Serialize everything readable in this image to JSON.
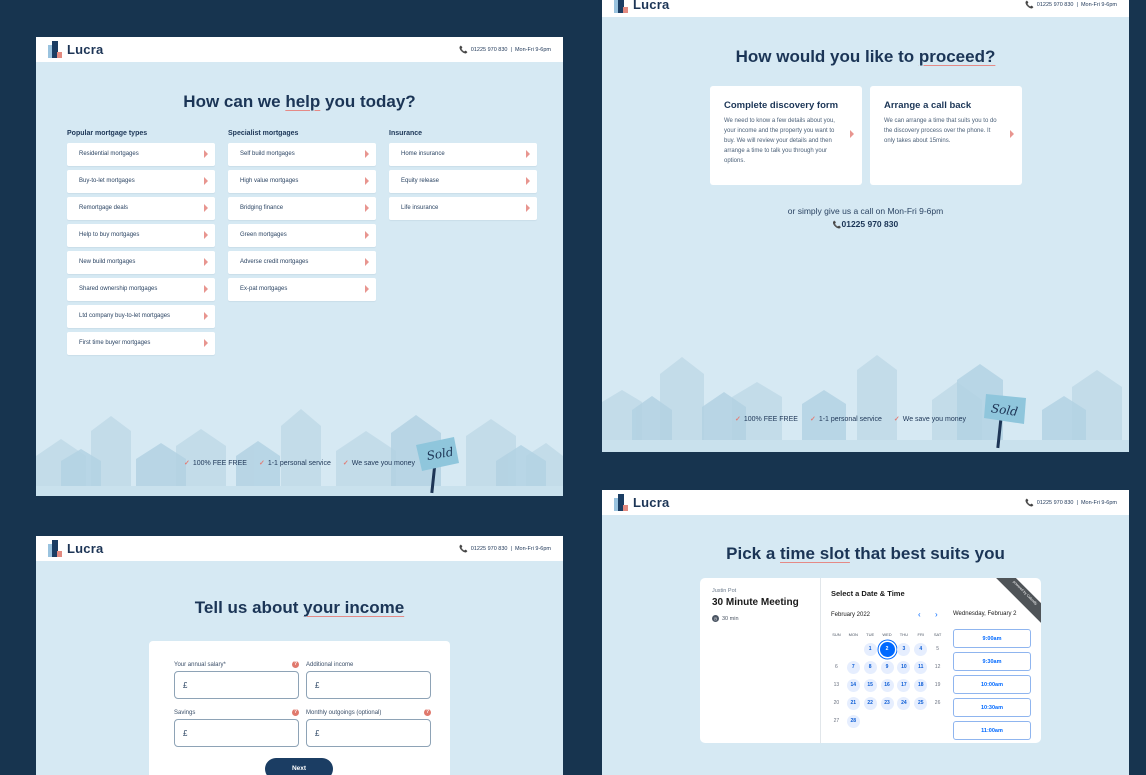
{
  "brand": {
    "name": "Lucra"
  },
  "contact": {
    "phone": "01225 970 830",
    "sep": "|",
    "hours": "Mon-Fri 9-6pm"
  },
  "features": [
    "100% FEE FREE",
    "1-1 personal service",
    "We save you money"
  ],
  "sign_text": "Sold",
  "panel_help": {
    "heading_pre": "How can we ",
    "heading_ul": "help",
    "heading_post": " you today?",
    "columns": [
      {
        "title": "Popular mortgage types",
        "items": [
          "Residential mortgages",
          "Buy-to-let mortgages",
          "Remortgage deals",
          "Help to buy mortgages",
          "New build mortgages",
          "Shared ownership mortgages",
          "Ltd company buy-to-let mortgages",
          "First time buyer mortgages"
        ]
      },
      {
        "title": "Specialist mortgages",
        "items": [
          "Self build mortgages",
          "High value mortgages",
          "Bridging finance",
          "Green mortgages",
          "Adverse credit mortgages",
          "Ex-pat mortgages"
        ]
      },
      {
        "title": "Insurance",
        "items": [
          "Home insurance",
          "Equity release",
          "Life insurance"
        ]
      }
    ]
  },
  "panel_proceed": {
    "heading_pre": "How would you like to ",
    "heading_ul": "proceed?",
    "cards": [
      {
        "title": "Complete discovery form",
        "body": "We need to know a few details about you, your income and the property you want to buy. We will review your details and then arrange a time to talk you through your options."
      },
      {
        "title": "Arrange a call back",
        "body": "We can arrange a time that suits you to do the discovery process over the phone. It only takes about 15mins."
      }
    ],
    "call_text": "or simply give us a call on Mon-Fri 9-6pm",
    "call_phone": "01225 970 830"
  },
  "panel_income": {
    "heading_pre": "Tell us about ",
    "heading_ul": "your income",
    "fields": [
      {
        "label": "Your annual salary*",
        "value": "£",
        "help": true
      },
      {
        "label": "Additional income",
        "value": "£",
        "help": false
      },
      {
        "label": "Savings",
        "value": "£",
        "help": true
      },
      {
        "label": "Monthly outgoings (optional)",
        "value": "£",
        "help": true
      }
    ],
    "help_glyph": "?",
    "next_label": "Next"
  },
  "panel_timeslot": {
    "heading_pre": "Pick a ",
    "heading_ul": "time slot",
    "heading_post": " that best suits you",
    "owner": "Justin Pot",
    "meeting_title": "30 Minute Meeting",
    "duration": "30 min",
    "cal_title": "Select a Date & Time",
    "month": "February 2022",
    "prev_arrow": "‹",
    "next_arrow": "›",
    "weekdays": [
      "SUN",
      "MON",
      "TUE",
      "WED",
      "THU",
      "FRI",
      "SAT"
    ],
    "weeks": [
      [
        "",
        "",
        "1",
        "2",
        "3",
        "4",
        "5"
      ],
      [
        "6",
        "7",
        "8",
        "9",
        "10",
        "11",
        "12"
      ],
      [
        "13",
        "14",
        "15",
        "16",
        "17",
        "18",
        "19"
      ],
      [
        "20",
        "21",
        "22",
        "23",
        "24",
        "25",
        "26"
      ],
      [
        "27",
        "28",
        "",
        "",
        "",
        "",
        ""
      ]
    ],
    "available_days": [
      "1",
      "3",
      "4",
      "7",
      "8",
      "9",
      "10",
      "11",
      "14",
      "15",
      "16",
      "17",
      "18",
      "21",
      "22",
      "23",
      "24",
      "25",
      "28"
    ],
    "selected_day": "2",
    "selected_label": "Wednesday, February 2",
    "slots": [
      "9:00am",
      "9:30am",
      "10:00am",
      "10:30am",
      "11:00am"
    ],
    "ribbon_text": "powered by Calendly"
  },
  "colors": {
    "navy": "#1b3556",
    "accent": "#e58a86",
    "panel_bg": "#d6e9f3",
    "calendly_blue": "#0069ff"
  }
}
